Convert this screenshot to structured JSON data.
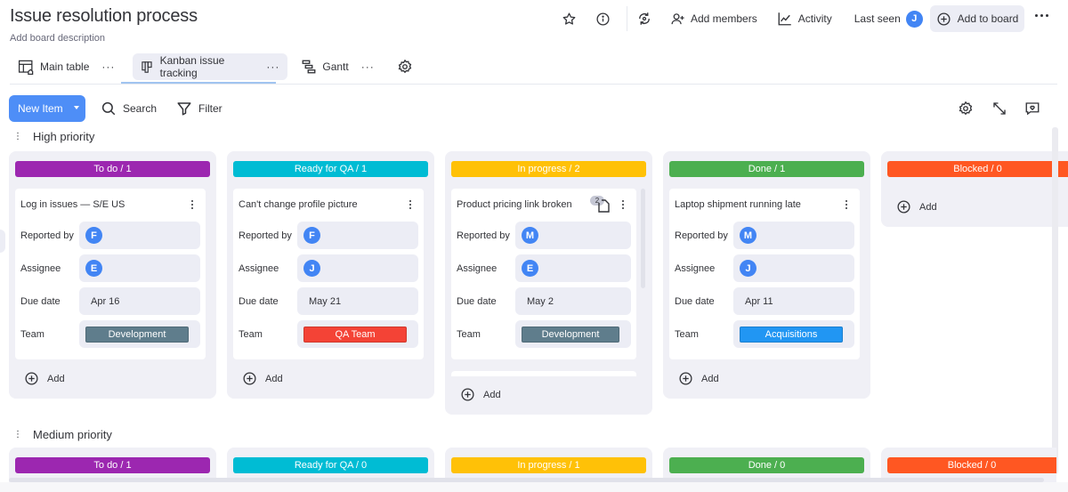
{
  "board": {
    "title": "Issue resolution process",
    "description": "Add board description"
  },
  "header": {
    "add_members": "Add members",
    "activity": "Activity",
    "last_seen": "Last seen",
    "last_seen_avatar": "J",
    "add_to_board": "Add to board"
  },
  "tabs": [
    {
      "label": "Main table",
      "icon": "table-home-icon"
    },
    {
      "label": "Kanban issue tracking",
      "icon": "kanban-icon",
      "active": true
    },
    {
      "label": "Gantt",
      "icon": "gantt-icon"
    }
  ],
  "toolbar": {
    "new_item": "New Item",
    "search": "Search",
    "filter": "Filter"
  },
  "groups": [
    {
      "name": "High priority",
      "columns": [
        {
          "header": "To do / 1",
          "color": "#9c27b0",
          "cards": [
            {
              "title": "Log in issues — S/E US",
              "reported_by": "F",
              "assignee": "E",
              "due_date": "Apr 16",
              "team": "Development",
              "team_color": "#5f7d8c"
            }
          ],
          "add_label": "Add"
        },
        {
          "header": "Ready for QA / 1",
          "color": "#00bcd4",
          "cards": [
            {
              "title": "Can't change profile picture",
              "reported_by": "F",
              "assignee": "J",
              "due_date": "May 21",
              "team": "QA Team",
              "team_color": "#f44336"
            }
          ],
          "add_label": "Add"
        },
        {
          "header": "In progress / 2",
          "color": "#ffc107",
          "cards": [
            {
              "title": "Product pricing link broken",
              "update_count": "2",
              "reported_by": "M",
              "assignee": "E",
              "due_date": "May 2",
              "team": "Development",
              "team_color": "#5f7d8c"
            }
          ],
          "add_label": "Add"
        },
        {
          "header": "Done / 1",
          "color": "#4caf50",
          "cards": [
            {
              "title": "Laptop shipment running late",
              "reported_by": "M",
              "assignee": "J",
              "due_date": "Apr 11",
              "team": "Acquisitions",
              "team_color": "#2196f3"
            }
          ],
          "add_label": "Add"
        },
        {
          "header": "Blocked / 0",
          "color": "#ff5722",
          "cards": [],
          "add_label": "Add"
        }
      ]
    },
    {
      "name": "Medium priority",
      "columns": [
        {
          "header": "To do / 1",
          "color": "#9c27b0"
        },
        {
          "header": "Ready for QA / 0",
          "color": "#00bcd4"
        },
        {
          "header": "In progress / 1",
          "color": "#ffc107"
        },
        {
          "header": "Done / 0",
          "color": "#4caf50"
        },
        {
          "header": "Blocked / 0",
          "color": "#ff5722"
        }
      ]
    }
  ],
  "field_labels": {
    "reported_by": "Reported by",
    "assignee": "Assignee",
    "due_date": "Due date",
    "team": "Team"
  }
}
